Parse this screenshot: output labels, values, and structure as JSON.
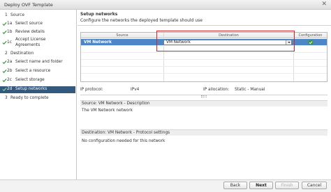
{
  "window": {
    "title": "Deploy OVF Template"
  },
  "sidebar": {
    "steps": [
      {
        "num": "1",
        "label": "Source",
        "group": true,
        "done": true,
        "active": false
      },
      {
        "num": "1a",
        "label": "Select source",
        "group": false,
        "done": true,
        "active": false
      },
      {
        "num": "1b",
        "label": "Review details",
        "group": false,
        "done": true,
        "active": false
      },
      {
        "num": "1c",
        "label": "Accept License",
        "label2": "Agreements",
        "group": false,
        "done": true,
        "active": false
      },
      {
        "num": "2",
        "label": "Destination",
        "group": true,
        "done": true,
        "active": false
      },
      {
        "num": "2a",
        "label": "Select name and folder",
        "group": false,
        "done": true,
        "active": false
      },
      {
        "num": "2b",
        "label": "Select a resource",
        "group": false,
        "done": true,
        "active": false
      },
      {
        "num": "2c",
        "label": "Select storage",
        "group": false,
        "done": true,
        "active": false
      },
      {
        "num": "2d",
        "label": "Setup networks",
        "group": false,
        "done": true,
        "active": true
      },
      {
        "num": "3",
        "label": "Ready to complete",
        "group": true,
        "done": false,
        "active": false
      }
    ]
  },
  "main": {
    "title": "Setup networks",
    "subtitle": "Configure the networks the deployed template should use",
    "table": {
      "columns": [
        "Source",
        "Destination",
        "Configuration"
      ],
      "rows": [
        {
          "source": "VM Network",
          "destination": "VM Network",
          "configuration_icon": "check-circle-icon"
        }
      ]
    },
    "ip_protocol_label": "IP protocol:",
    "ip_protocol_value": "IPv4",
    "ip_allocation_label": "IP allocation:",
    "ip_allocation_value": "Static - Manual",
    "source_section_title": "Source: VM Network - Description",
    "source_section_text": "The VM Network network",
    "dest_section_title": "Destination: VM Network - Protocol settings",
    "dest_section_text": "No configuration needed for this network"
  },
  "footer": {
    "back": "Back",
    "next": "Next",
    "finish": "Finish",
    "cancel": "Cancel"
  },
  "colors": {
    "active_step": "#34597e",
    "selected_row": "#4d86c6",
    "check_green": "#3a9a3a",
    "highlight_red": "#d9232a"
  }
}
